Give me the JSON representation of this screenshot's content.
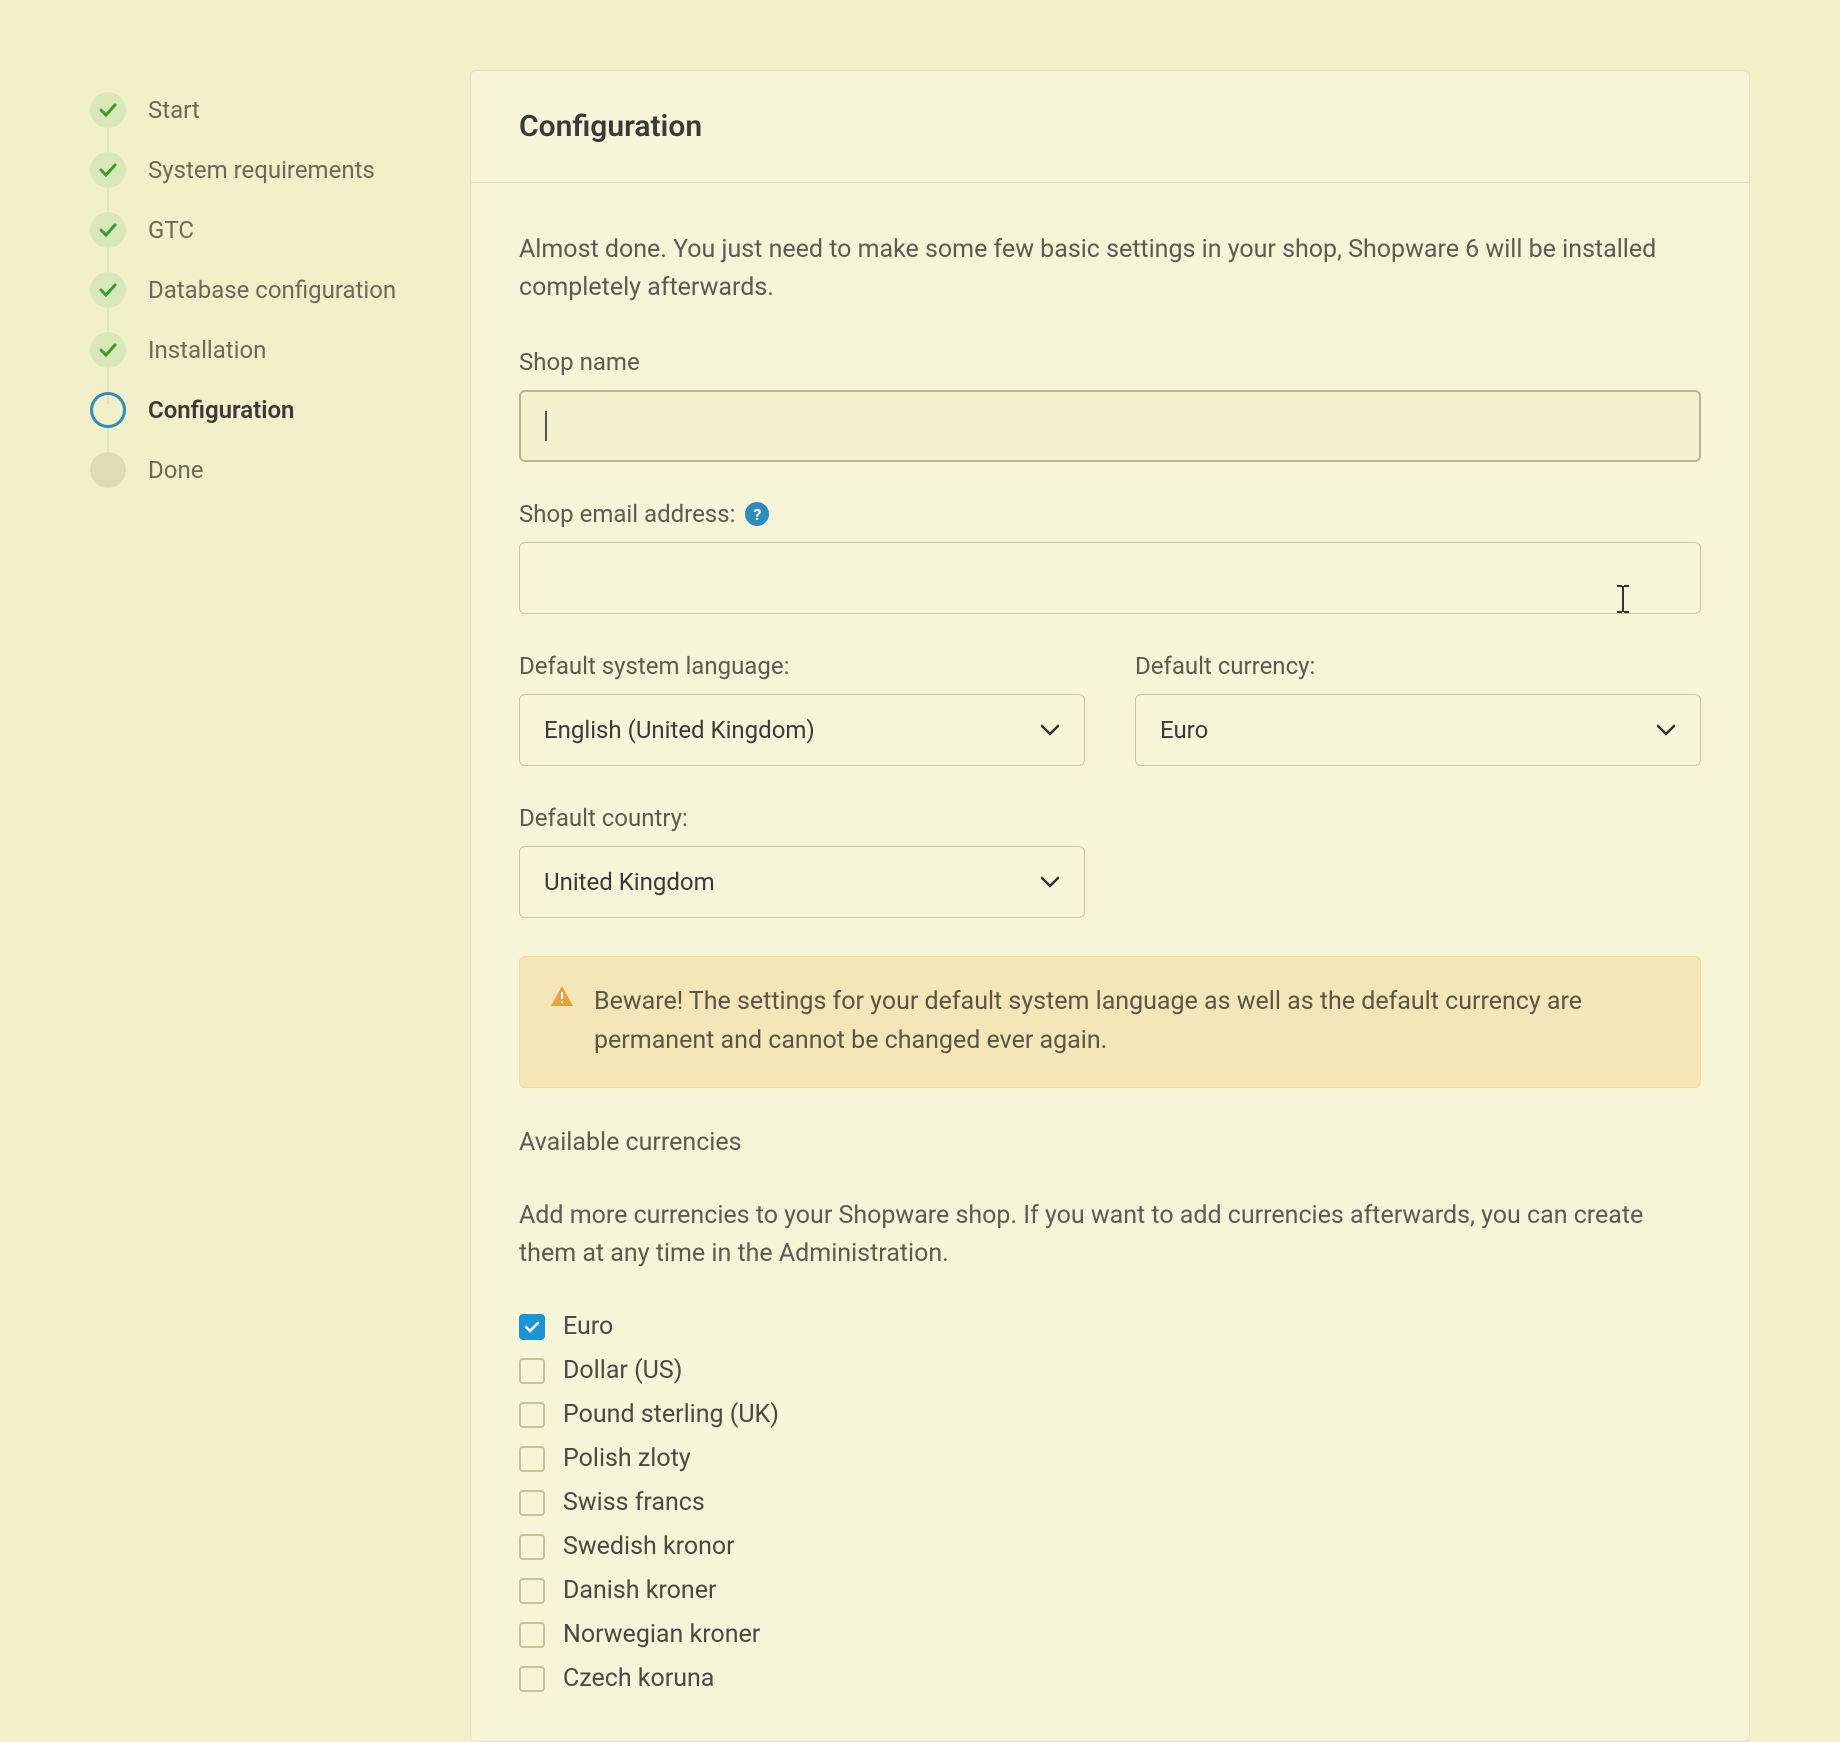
{
  "steps": [
    {
      "label": "Start",
      "state": "done"
    },
    {
      "label": "System requirements",
      "state": "done"
    },
    {
      "label": "GTC",
      "state": "done"
    },
    {
      "label": "Database configuration",
      "state": "done"
    },
    {
      "label": "Installation",
      "state": "done"
    },
    {
      "label": "Configuration",
      "state": "active"
    },
    {
      "label": "Done",
      "state": "pending"
    }
  ],
  "page": {
    "title": "Configuration",
    "intro": "Almost done. You just need to make some few basic settings in your shop, Shopware 6 will be installed completely afterwards."
  },
  "fields": {
    "shop_name": {
      "label": "Shop name",
      "value": ""
    },
    "shop_email": {
      "label": "Shop email address:",
      "value": ""
    },
    "language": {
      "label": "Default system language:",
      "value": "English (United Kingdom)"
    },
    "currency": {
      "label": "Default currency:",
      "value": "Euro"
    },
    "country": {
      "label": "Default country:",
      "value": "United Kingdom"
    }
  },
  "alert": {
    "text": "Beware! The settings for your default system language as well as the default currency are permanent and cannot be changed ever again."
  },
  "currencies": {
    "title": "Available currencies",
    "desc": "Add more currencies to your Shopware shop. If you want to add currencies afterwards, you can create them at any time in the Administration.",
    "items": [
      {
        "label": "Euro",
        "checked": true
      },
      {
        "label": "Dollar (US)",
        "checked": false
      },
      {
        "label": "Pound sterling (UK)",
        "checked": false
      },
      {
        "label": "Polish zloty",
        "checked": false
      },
      {
        "label": "Swiss francs",
        "checked": false
      },
      {
        "label": "Swedish kronor",
        "checked": false
      },
      {
        "label": "Danish kroner",
        "checked": false
      },
      {
        "label": "Norwegian kroner",
        "checked": false
      },
      {
        "label": "Czech koruna",
        "checked": false
      }
    ]
  }
}
